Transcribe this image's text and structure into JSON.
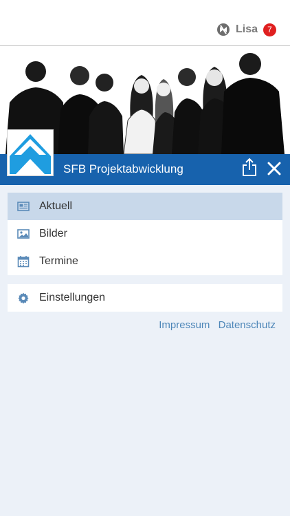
{
  "user": {
    "name": "Lisa",
    "badge_count": "7"
  },
  "app": {
    "title": "SFB Projektabwicklung"
  },
  "menu": {
    "items": [
      {
        "label": "Aktuell",
        "icon": "newspaper-icon",
        "active": true
      },
      {
        "label": "Bilder",
        "icon": "image-icon",
        "active": false
      },
      {
        "label": "Termine",
        "icon": "calendar-icon",
        "active": false
      }
    ],
    "settings": {
      "label": "Einstellungen",
      "icon": "gear-icon"
    }
  },
  "footer": {
    "impressum": "Impressum",
    "datenschutz": "Datenschutz"
  },
  "colors": {
    "primary": "#1762ad",
    "active_row": "#c8d8ea",
    "background": "#ecf1f8",
    "badge": "#e02020",
    "link": "#4d86b8"
  }
}
